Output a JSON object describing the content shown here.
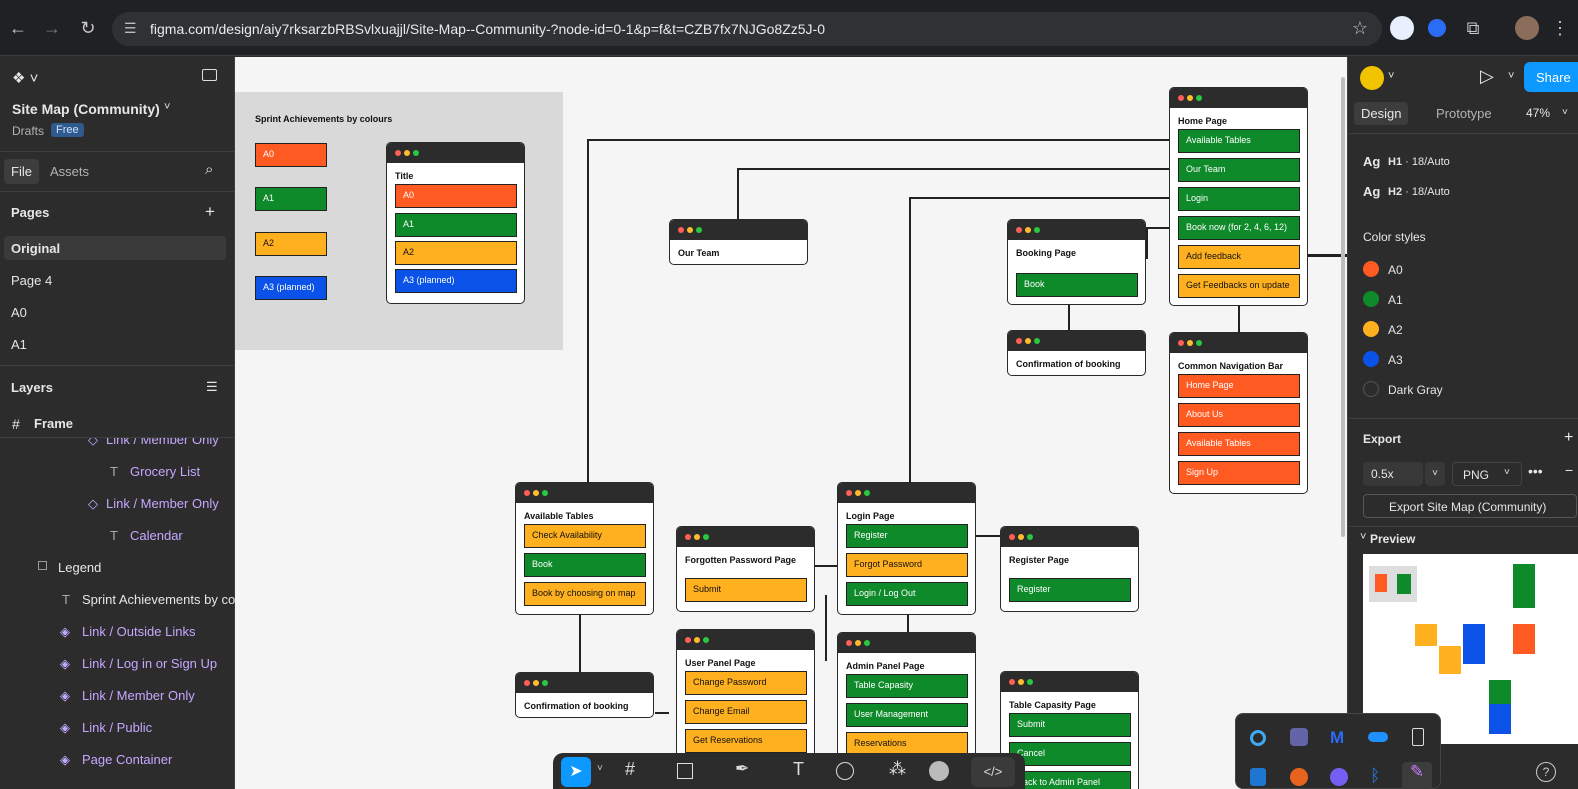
{
  "browser": {
    "url": "figma.com/design/aiy7rksarzbRBSvlxuajjl/Site-Map--Community-?node-id=0-1&p=f&t=CZB7fx7NJGo8Zz5J-0"
  },
  "left": {
    "file_name": "Site Map (Community)",
    "drafts": "Drafts",
    "plan": "Free",
    "tab_file": "File",
    "tab_assets": "Assets",
    "pages_label": "Pages",
    "pages": [
      "Original",
      "Page 4",
      "A0",
      "A1"
    ],
    "layers_label": "Layers",
    "frame_layer": "Frame",
    "layers": [
      {
        "label": "Link / Member Only",
        "type": "component"
      },
      {
        "label": "Grocery List",
        "type": "text"
      },
      {
        "label": "Link / Member Only",
        "type": "component"
      },
      {
        "label": "Calendar",
        "type": "text"
      },
      {
        "label": "Legend",
        "type": "frame"
      },
      {
        "label": "Sprint Achievements by colou",
        "type": "text"
      },
      {
        "label": "Link / Outside Links",
        "type": "instance"
      },
      {
        "label": "Link / Log in or Sign Up",
        "type": "instance"
      },
      {
        "label": "Link / Member Only",
        "type": "instance"
      },
      {
        "label": "Link / Public",
        "type": "instance"
      },
      {
        "label": "Page Container",
        "type": "instance"
      }
    ]
  },
  "right": {
    "share": "Share",
    "tab_design": "Design",
    "tab_prototype": "Prototype",
    "zoom": "47%",
    "text_styles": [
      {
        "name": "H1",
        "spec": " · 18/Auto"
      },
      {
        "name": "H2",
        "spec": " · 18/Auto"
      }
    ],
    "color_styles_label": "Color styles",
    "colors": [
      {
        "name": "A0",
        "hex": "#ff5a22"
      },
      {
        "name": "A1",
        "hex": "#0e8a2a"
      },
      {
        "name": "A2",
        "hex": "#ffb01f"
      },
      {
        "name": "A3",
        "hex": "#0a52e8"
      },
      {
        "name": "Dark Gray",
        "hex": "#2c2c2c"
      }
    ],
    "export_label": "Export",
    "export_scale": "0.5x",
    "export_format": "PNG",
    "export_button": "Export Site Map (Community)",
    "preview_label": "Preview"
  },
  "legend": {
    "title": "Sprint Achievements by colours",
    "items": [
      "A0",
      "A1",
      "A2",
      "A3 (planned)"
    ],
    "frame_title": "Title"
  },
  "pages": {
    "home": {
      "title": "Home Page",
      "items": [
        "Available Tables",
        "Our Team",
        "Login",
        "Book now (for 2, 4, 6, 12)",
        "Add feedback",
        "Get Feedbacks on update"
      ]
    },
    "our_team": {
      "title": "Our Team"
    },
    "booking": {
      "title": "Booking Page",
      "items": [
        "Book"
      ]
    },
    "confirm1": {
      "title": "Confirmation of booking"
    },
    "nav": {
      "title": "Common Navigation Bar",
      "items": [
        "Home Page",
        "About Us",
        "Available Tables",
        "Sign Up"
      ]
    },
    "available": {
      "title": "Available Tables",
      "items": [
        "Check Availability",
        "Book",
        "Book by choosing on map"
      ]
    },
    "forgot": {
      "title": "Forgotten Password Page",
      "items": [
        "Submit"
      ]
    },
    "login": {
      "title": "Login Page",
      "items": [
        "Register",
        "Forgot Password",
        "Login / Log Out"
      ]
    },
    "register": {
      "title": "Register Page",
      "items": [
        "Register"
      ]
    },
    "confirm2": {
      "title": "Confirmation of booking"
    },
    "user": {
      "title": "User Panel Page",
      "items": [
        "Change Password",
        "Change Email",
        "Get Reservations"
      ]
    },
    "admin": {
      "title": "Admin Panel Page",
      "items": [
        "Table Capasity",
        "User Management",
        "Reservations"
      ]
    },
    "tablecap": {
      "title": "Table Capasity Page",
      "items": [
        "Submit",
        "Cancel",
        "Back to Admin Panel"
      ]
    }
  }
}
